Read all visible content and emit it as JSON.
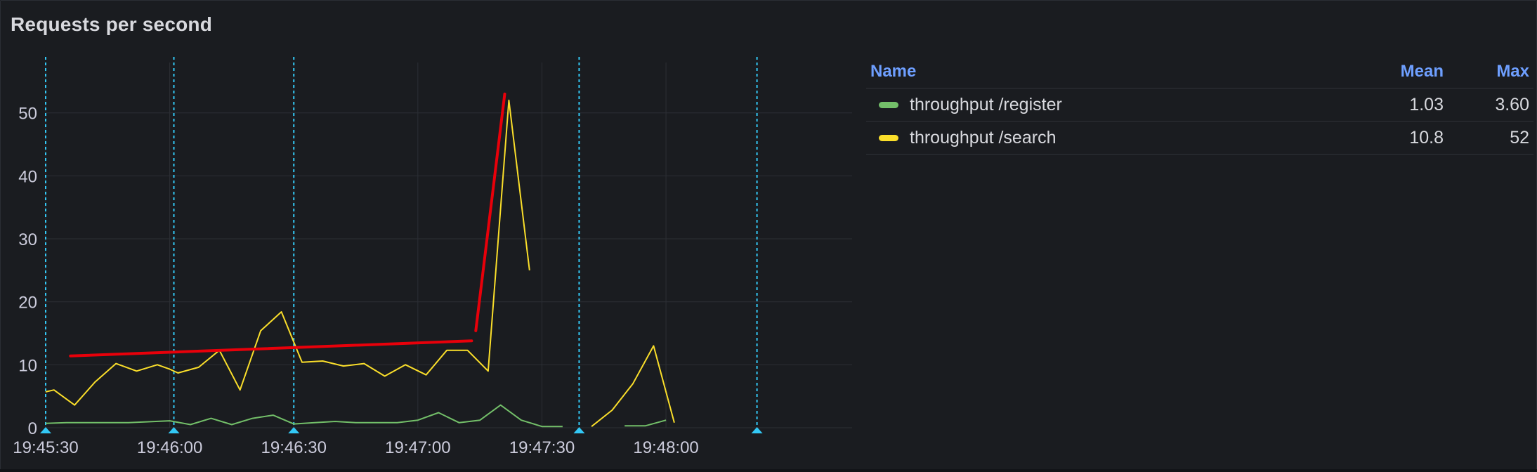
{
  "panel": {
    "title": "Requests per second"
  },
  "legend": {
    "headers": {
      "name": "Name",
      "mean": "Mean",
      "max": "Max"
    },
    "rows": [
      {
        "name": "throughput /register",
        "mean": "1.03",
        "max": "3.60",
        "color": "#73bf69"
      },
      {
        "name": "throughput /search",
        "mean": "10.8",
        "max": "52",
        "color": "#fade2a"
      }
    ]
  },
  "chart_data": {
    "type": "line",
    "title": "Requests per second",
    "xlabel": "",
    "ylabel": "",
    "ylim": [
      0,
      58
    ],
    "y_ticks": [
      0,
      10,
      20,
      30,
      40,
      50
    ],
    "x_range": [
      "19:45:30",
      "19:48:45"
    ],
    "x_ticks": [
      "19:45:30",
      "19:46:00",
      "19:46:30",
      "19:47:00",
      "19:47:30",
      "19:48:00"
    ],
    "grid": true,
    "colors": {
      "register": "#73bf69",
      "search": "#fade2a",
      "annotation": "#33c8f5",
      "trend": "#e8000a"
    },
    "series": [
      {
        "name": "throughput /register",
        "color": "#73bf69",
        "segments": [
          [
            [
              "19:45:30",
              0.7
            ],
            [
              "19:45:35",
              0.8
            ],
            [
              "19:45:50",
              0.8
            ],
            [
              "19:46:00",
              1.1
            ],
            [
              "19:46:05",
              0.5
            ],
            [
              "19:46:10",
              1.5
            ],
            [
              "19:46:15",
              0.5
            ],
            [
              "19:46:20",
              1.5
            ],
            [
              "19:46:25",
              2.0
            ],
            [
              "19:46:30",
              0.6
            ],
            [
              "19:46:35",
              0.8
            ],
            [
              "19:46:40",
              1.0
            ],
            [
              "19:46:45",
              0.8
            ],
            [
              "19:46:50",
              0.8
            ],
            [
              "19:46:55",
              0.8
            ],
            [
              "19:47:00",
              1.2
            ],
            [
              "19:47:05",
              2.4
            ],
            [
              "19:47:10",
              0.8
            ],
            [
              "19:47:15",
              1.2
            ],
            [
              "19:47:20",
              3.6
            ],
            [
              "19:47:25",
              1.2
            ],
            [
              "19:47:30",
              0.2
            ],
            [
              "19:47:35",
              0.2
            ]
          ],
          [
            [
              "19:47:50",
              0.3
            ],
            [
              "19:47:55",
              0.3
            ],
            [
              "19:48:00",
              1.2
            ]
          ]
        ]
      },
      {
        "name": "throughput /search",
        "color": "#fade2a",
        "segments": [
          [
            [
              "19:45:30",
              5.7
            ],
            [
              "19:45:32",
              6.0
            ],
            [
              "19:45:37",
              3.6
            ],
            [
              "19:45:42",
              7.3
            ],
            [
              "19:45:47",
              10.2
            ],
            [
              "19:45:52",
              9.0
            ],
            [
              "19:45:57",
              10.0
            ],
            [
              "19:46:00",
              9.3
            ],
            [
              "19:46:02",
              8.7
            ],
            [
              "19:46:07",
              9.6
            ],
            [
              "19:46:12",
              12.3
            ],
            [
              "19:46:17",
              6.0
            ],
            [
              "19:46:22",
              15.4
            ],
            [
              "19:46:27",
              18.4
            ],
            [
              "19:46:32",
              10.4
            ],
            [
              "19:46:37",
              10.6
            ],
            [
              "19:46:42",
              9.8
            ],
            [
              "19:46:47",
              10.2
            ],
            [
              "19:46:52",
              8.2
            ],
            [
              "19:46:57",
              10.0
            ],
            [
              "19:47:02",
              8.4
            ],
            [
              "19:47:07",
              12.3
            ],
            [
              "19:47:12",
              12.3
            ],
            [
              "19:47:17",
              9.0
            ],
            [
              "19:47:22",
              52.0
            ],
            [
              "19:47:27",
              25.0
            ]
          ],
          [
            [
              "19:47:42",
              0.2
            ],
            [
              "19:47:47",
              2.8
            ],
            [
              "19:47:52",
              7.0
            ],
            [
              "19:47:57",
              13.0
            ],
            [
              "19:48:02",
              0.8
            ]
          ]
        ]
      }
    ],
    "annotations": [
      "19:45:30",
      "19:46:01",
      "19:46:30",
      "19:47:39",
      "19:48:22"
    ],
    "overlay_marks": [
      {
        "color": "#e8000a",
        "points": [
          [
            "19:45:36",
            11.4
          ],
          [
            "19:47:13",
            13.8
          ]
        ]
      },
      {
        "color": "#e8000a",
        "points": [
          [
            "19:47:14",
            15.4
          ],
          [
            "19:47:21",
            53.0
          ]
        ]
      }
    ]
  }
}
